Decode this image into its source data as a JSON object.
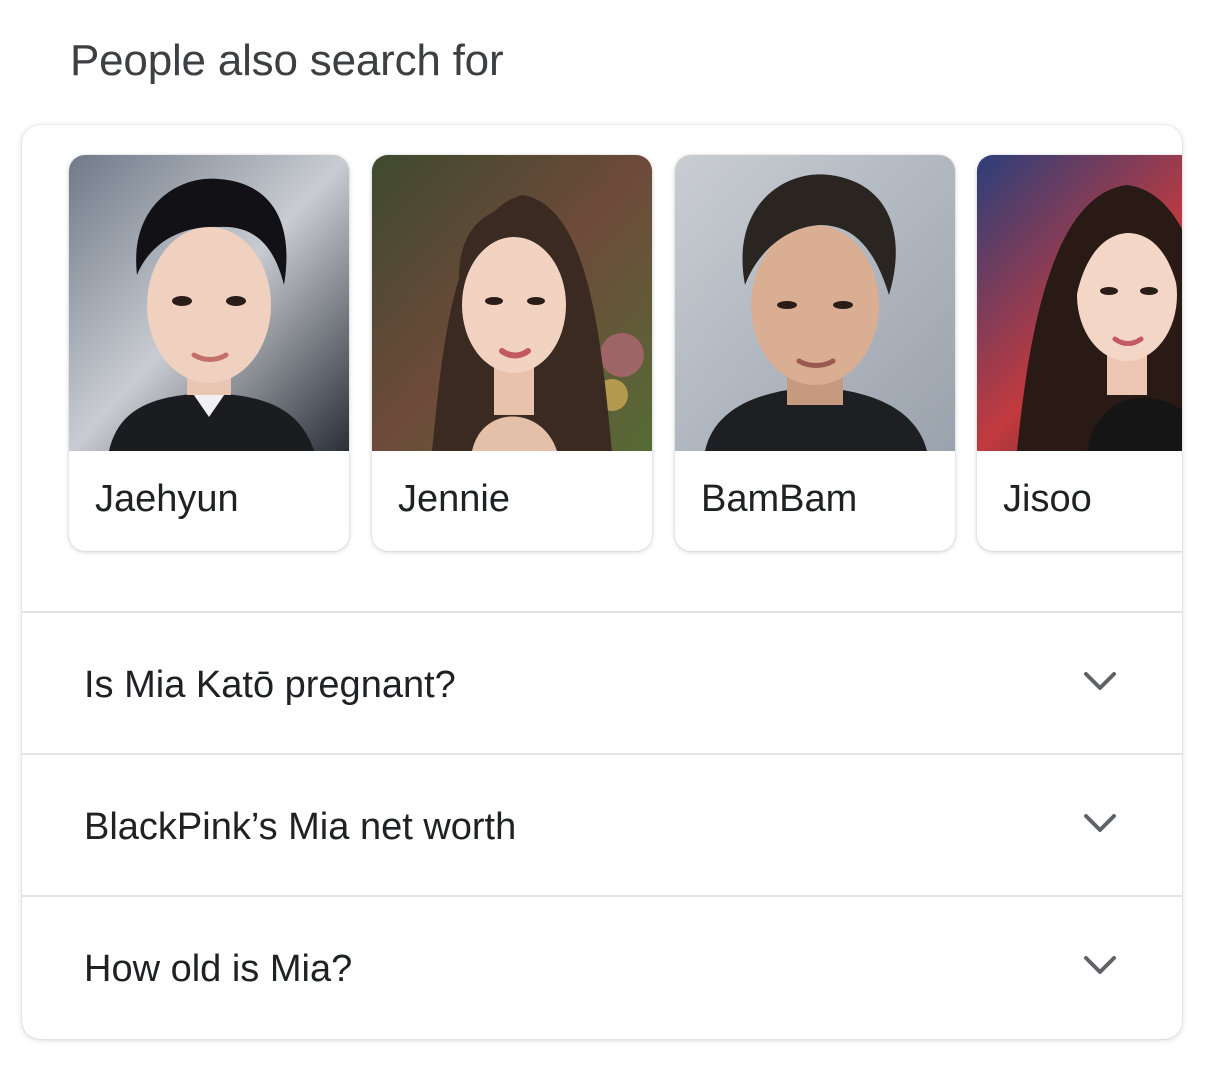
{
  "section": {
    "title": "People also search for"
  },
  "people": [
    {
      "name": "Jaehyun",
      "photo_icon": "person-portrait-icon"
    },
    {
      "name": "Jennie",
      "photo_icon": "person-portrait-icon"
    },
    {
      "name": "BamBam",
      "photo_icon": "person-portrait-icon"
    },
    {
      "name": "Jisoo",
      "photo_icon": "person-portrait-icon"
    }
  ],
  "questions": [
    {
      "text": "Is Mia Katō pregnant?",
      "icon": "chevron-down-icon"
    },
    {
      "text": "BlackPink’s Mia net worth",
      "icon": "chevron-down-icon"
    },
    {
      "text": "How old is Mia?",
      "icon": "chevron-down-icon"
    }
  ],
  "colors": {
    "text_primary": "#202124",
    "text_secondary": "#3c4043",
    "divider": "#e3e4e6",
    "chevron": "#5f6368"
  }
}
